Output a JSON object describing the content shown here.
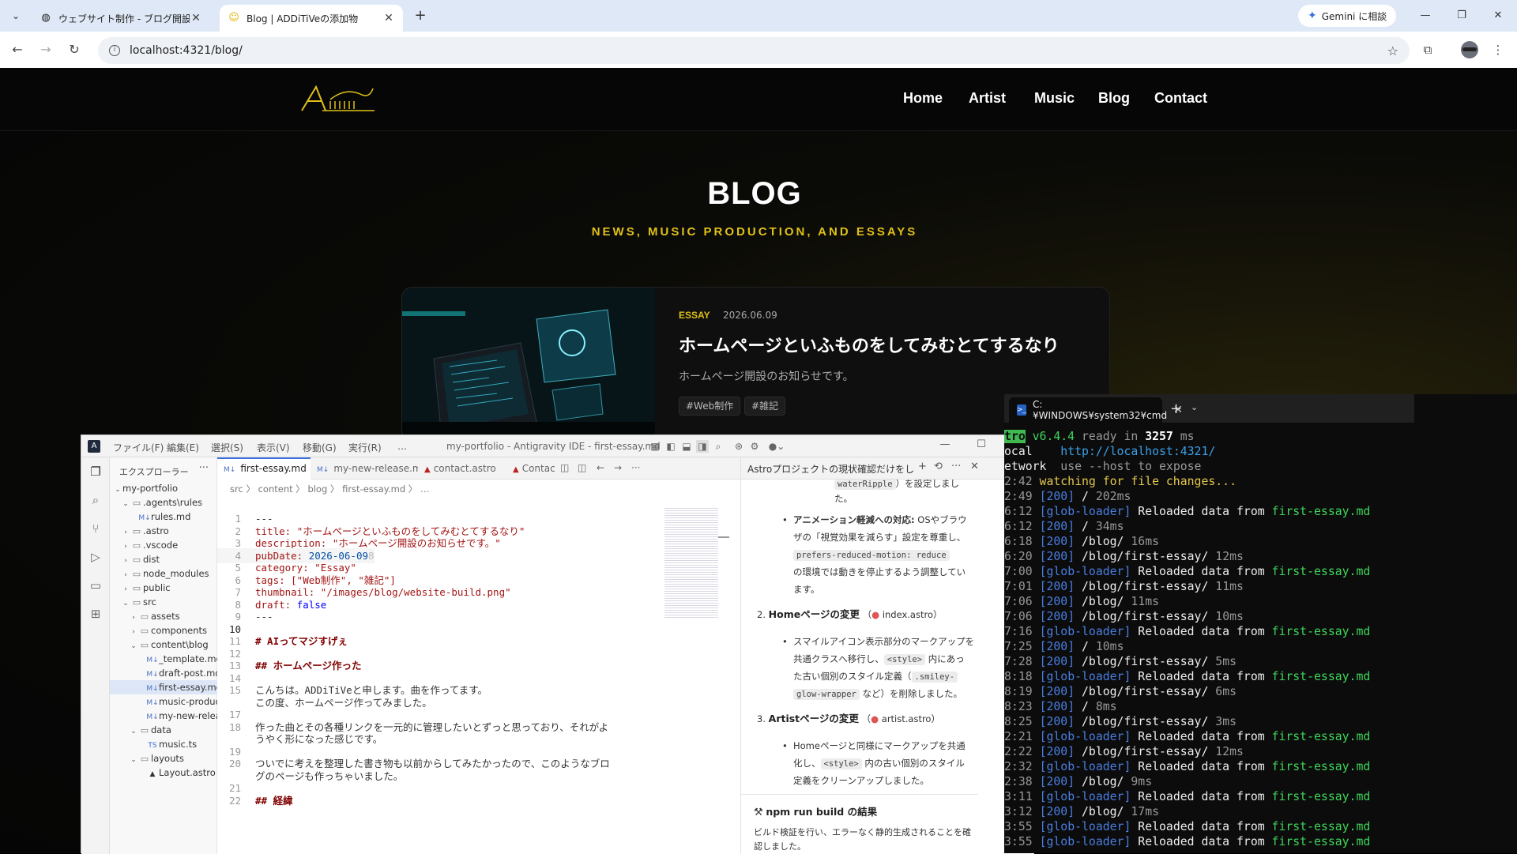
{
  "browser": {
    "tabs": [
      {
        "title": "ウェブサイト制作 - ブログ開設記事",
        "active": false
      },
      {
        "title": "Blog | ADDiTiVeの添加物",
        "active": true
      }
    ],
    "gemini_label": "Gemini に相談",
    "url": "localhost:4321/blog/"
  },
  "site": {
    "logo_text": "ADDiTiV",
    "nav": [
      "Home",
      "Artist",
      "Music",
      "Blog",
      "Contact"
    ],
    "hero_title": "BLOG",
    "hero_subtitle": "NEWS, MUSIC PRODUCTION, AND ESSAYS",
    "post": {
      "category": "ESSAY",
      "date": "2026.06.09",
      "title": "ホームページといふものをしてみむとてするなり",
      "description": "ホームページ開設のお知らせです。",
      "tags": [
        "#Web制作",
        "#雑記"
      ]
    }
  },
  "ide": {
    "menu": [
      "ファイル(F)",
      "編集(E)",
      "選択(S)",
      "表示(V)",
      "移動(G)",
      "実行(R)",
      "…"
    ],
    "window_title": "my-portfolio - Antigravity IDE - first-essay.md",
    "explorer_title": "エクスプローラー",
    "tree": [
      {
        "label": "my-portfolio",
        "depth": 0,
        "type": "root",
        "open": true
      },
      {
        "label": ".agents\\rules",
        "depth": 1,
        "type": "folder",
        "open": true
      },
      {
        "label": "rules.md",
        "depth": 2,
        "type": "md"
      },
      {
        "label": ".astro",
        "depth": 1,
        "type": "folder",
        "open": false
      },
      {
        "label": ".vscode",
        "depth": 1,
        "type": "folder",
        "open": false
      },
      {
        "label": "dist",
        "depth": 1,
        "type": "folder",
        "open": false
      },
      {
        "label": "node_modules",
        "depth": 1,
        "type": "folder",
        "open": false
      },
      {
        "label": "public",
        "depth": 1,
        "type": "folder",
        "open": false
      },
      {
        "label": "src",
        "depth": 1,
        "type": "folder",
        "open": true
      },
      {
        "label": "assets",
        "depth": 2,
        "type": "folder",
        "open": false
      },
      {
        "label": "components",
        "depth": 2,
        "type": "folder",
        "open": false
      },
      {
        "label": "content\\blog",
        "depth": 2,
        "type": "folder",
        "open": true
      },
      {
        "label": "_template.md",
        "depth": 3,
        "type": "md"
      },
      {
        "label": "draft-post.md",
        "depth": 3,
        "type": "md"
      },
      {
        "label": "first-essay.md",
        "depth": 3,
        "type": "md",
        "selected": true
      },
      {
        "label": "music-producti...",
        "depth": 3,
        "type": "md"
      },
      {
        "label": "my-new-releas...",
        "depth": 3,
        "type": "md"
      },
      {
        "label": "data",
        "depth": 2,
        "type": "folder",
        "open": true
      },
      {
        "label": "music.ts",
        "depth": 3,
        "type": "ts"
      },
      {
        "label": "layouts",
        "depth": 2,
        "type": "folder",
        "open": true
      },
      {
        "label": "Layout.astro",
        "depth": 3,
        "type": "astro"
      }
    ],
    "editor_tabs": [
      {
        "label": "first-essay.md",
        "kind": "md",
        "active": true
      },
      {
        "label": "my-new-release.md",
        "kind": "md",
        "active": false
      },
      {
        "label": "contact.astro",
        "kind": "astro",
        "active": false
      },
      {
        "label": "Contac",
        "kind": "astro",
        "active": false
      }
    ],
    "breadcrumb": "src 〉 content 〉 blog 〉 first-essay.md 〉 …",
    "code": [
      {
        "n": "1",
        "t": "---"
      },
      {
        "n": "2",
        "k": "title: ",
        "v": "\"ホームページといふものをしてみむとてするなり\""
      },
      {
        "n": "3",
        "k": "description: ",
        "v": "\"ホームページ開設のお知らせです。\""
      },
      {
        "n": "4",
        "k": "pubDate: ",
        "num": "2026-06-09",
        "ghost": "8"
      },
      {
        "n": "5",
        "k": "category: ",
        "v": "\"Essay\""
      },
      {
        "n": "6",
        "k": "tags: ",
        "v": "[\"Web制作\", \"雑記\"]"
      },
      {
        "n": "7",
        "k": "thumbnail: ",
        "v": "\"/images/blog/website-build.png\""
      },
      {
        "n": "8",
        "k": "draft: ",
        "bool": "false"
      },
      {
        "n": "9",
        "t": "---"
      },
      {
        "n": "10",
        "t": ""
      },
      {
        "n": "11",
        "h": "# AIってマジすげぇ"
      },
      {
        "n": "12",
        "t": ""
      },
      {
        "n": "13",
        "h": "## ホームページ作った"
      },
      {
        "n": "14",
        "t": ""
      },
      {
        "n": "15",
        "t": "こんちは。ADDiTiVeと申します。曲を作ってます。"
      },
      {
        "n": "",
        "t": "この度、ホームページ作ってみました。"
      },
      {
        "n": "17",
        "t": ""
      },
      {
        "n": "18",
        "t": "作った曲とその各種リンクを一元的に管理したいとずっと思っており、それがよ"
      },
      {
        "n": "",
        "t": "うやく形になった感じです。"
      },
      {
        "n": "19",
        "t": ""
      },
      {
        "n": "20",
        "t": "ついでに考えを整理した書き物も以前からしてみたかったので、このようなブロ"
      },
      {
        "n": "",
        "t": "グのページも作っちゃいました。"
      },
      {
        "n": "21",
        "t": ""
      },
      {
        "n": "22",
        "h": "## 経緯"
      }
    ],
    "chat": {
      "title": "Astroプロジェクトの現状確認だけをしてくだ",
      "items": {
        "top_chip": "waterRipple",
        "top_tail": "）を設定しまし",
        "top_tail2": "た。",
        "b1_head": "アニメーション軽減への対応:",
        "b1_rest": " OSやブラウ",
        "b1_l2": "ザの「視覚効果を減らす」設定を尊重し、",
        "b1_chip": "prefers-reduced-motion: reduce",
        "b1_l4": "の環境では動きを停止するよう調整してい",
        "b1_l5": "ます。",
        "h2_num": "2.",
        "h2": "Homeページの変更",
        "h2_file": "index.astro",
        "b2_l1": "スマイルアイコン表示部分のマークアップを",
        "b2_l2a": "共通クラスへ移行し、",
        "b2_chip": "<style>",
        "b2_l2b": " 内にあっ",
        "b2_l3a": "た古い個別のスタイル定義（",
        "b2_chip2": ".smiley-",
        "b2_chip3": "glow-wrapper",
        "b2_l4b": " など）を削除しました。",
        "h3_num": "3.",
        "h3": "Artistページの変更",
        "h3_file": "artist.astro",
        "b3_l1": "Homeページと同様にマークアップを共通",
        "b3_l2a": "化し、",
        "b3_chip": "<style>",
        "b3_l2b": " 内の古い個別のスタイル",
        "b3_l3": "定義をクリーンアップしました。",
        "h4": "npm run build の結果",
        "p4": "ビルド検証を行い、エラーなく静的生成されることを確",
        "p4b": "認しました。"
      }
    }
  },
  "terminal": {
    "tab_title": "C:¥WINDOWS¥system32¥cmd",
    "lines": [
      {
        "type": "ready",
        "a": "tro",
        "b": " v6.4.4 ",
        "c": "ready in ",
        "d": "3257",
        "e": " ms"
      },
      {
        "type": "kv",
        "k": "ocal    ",
        "v": "http://localhost:4321/"
      },
      {
        "type": "kv2",
        "k": "etwork  ",
        "v": "use --host to expose"
      },
      {
        "type": "watch",
        "ts": "2:42",
        "msg": " watching for file changes..."
      },
      {
        "type": "req",
        "ts": "2:49",
        "path": " / ",
        "time": "202ms"
      },
      {
        "type": "glob",
        "ts": "6:12",
        "file": "first-essay.md"
      },
      {
        "type": "req",
        "ts": "6:12",
        "path": " / ",
        "time": "34ms"
      },
      {
        "type": "req",
        "ts": "6:18",
        "path": " /blog/ ",
        "time": "16ms"
      },
      {
        "type": "req",
        "ts": "6:20",
        "path": " /blog/first-essay/ ",
        "time": "12ms"
      },
      {
        "type": "glob",
        "ts": "7:00",
        "file": "first-essay.md"
      },
      {
        "type": "req",
        "ts": "7:01",
        "path": " /blog/first-essay/ ",
        "time": "11ms"
      },
      {
        "type": "req",
        "ts": "7:06",
        "path": " /blog/ ",
        "time": "11ms"
      },
      {
        "type": "req",
        "ts": "7:06",
        "path": " /blog/first-essay/ ",
        "time": "10ms"
      },
      {
        "type": "glob",
        "ts": "7:16",
        "file": "first-essay.md"
      },
      {
        "type": "req",
        "ts": "7:25",
        "path": " / ",
        "time": "10ms"
      },
      {
        "type": "req",
        "ts": "7:28",
        "path": " /blog/first-essay/ ",
        "time": "5ms"
      },
      {
        "type": "glob",
        "ts": "8:18",
        "file": "first-essay.md"
      },
      {
        "type": "req",
        "ts": "8:19",
        "path": " /blog/first-essay/ ",
        "time": "6ms"
      },
      {
        "type": "req",
        "ts": "8:23",
        "path": " / ",
        "time": "8ms"
      },
      {
        "type": "req",
        "ts": "8:25",
        "path": " /blog/first-essay/ ",
        "time": "3ms"
      },
      {
        "type": "glob",
        "ts": "2:21",
        "file": "first-essay.md"
      },
      {
        "type": "req",
        "ts": "2:22",
        "path": " /blog/first-essay/ ",
        "time": "12ms"
      },
      {
        "type": "glob",
        "ts": "2:32",
        "file": "first-essay.md"
      },
      {
        "type": "req",
        "ts": "2:38",
        "path": " /blog/ ",
        "time": "9ms"
      },
      {
        "type": "glob",
        "ts": "3:11",
        "file": "first-essay.md"
      },
      {
        "type": "req",
        "ts": "3:12",
        "path": " /blog/ ",
        "time": "17ms"
      },
      {
        "type": "glob",
        "ts": "3:55",
        "file": "first-essay.md"
      },
      {
        "type": "glob",
        "ts": "3:55",
        "file": "first-essay.md"
      }
    ],
    "status_200": "[200]",
    "glob_label": "[glob-loader]",
    "glob_msg": " Reloaded data from "
  }
}
